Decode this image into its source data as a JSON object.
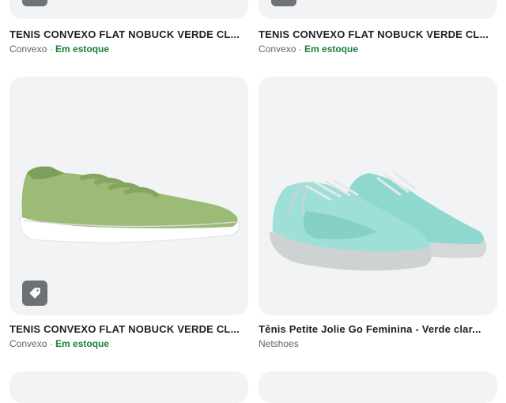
{
  "products": [
    {
      "title": "TENIS CONVEXO FLAT NOBUCK VERDE CL...",
      "seller": "Convexo",
      "sep": " · ",
      "stock": "Em estoque",
      "icon": "tag-icon"
    },
    {
      "title": "TENIS CONVEXO FLAT NOBUCK VERDE CL...",
      "seller": "Convexo",
      "sep": " · ",
      "stock": "Em estoque",
      "icon": "tag-icon"
    },
    {
      "title": "TENIS CONVEXO FLAT NOBUCK VERDE CL...",
      "seller": "Convexo",
      "sep": " · ",
      "stock": "Em estoque",
      "icon": "tag-icon"
    },
    {
      "title": "Tênis Petite Jolie Go Feminina - Verde clar...",
      "seller": "Netshoes"
    }
  ],
  "colors": {
    "stock": "#188038",
    "card_bg": "#f1f3f4",
    "tag_bg": "#5f6368"
  }
}
